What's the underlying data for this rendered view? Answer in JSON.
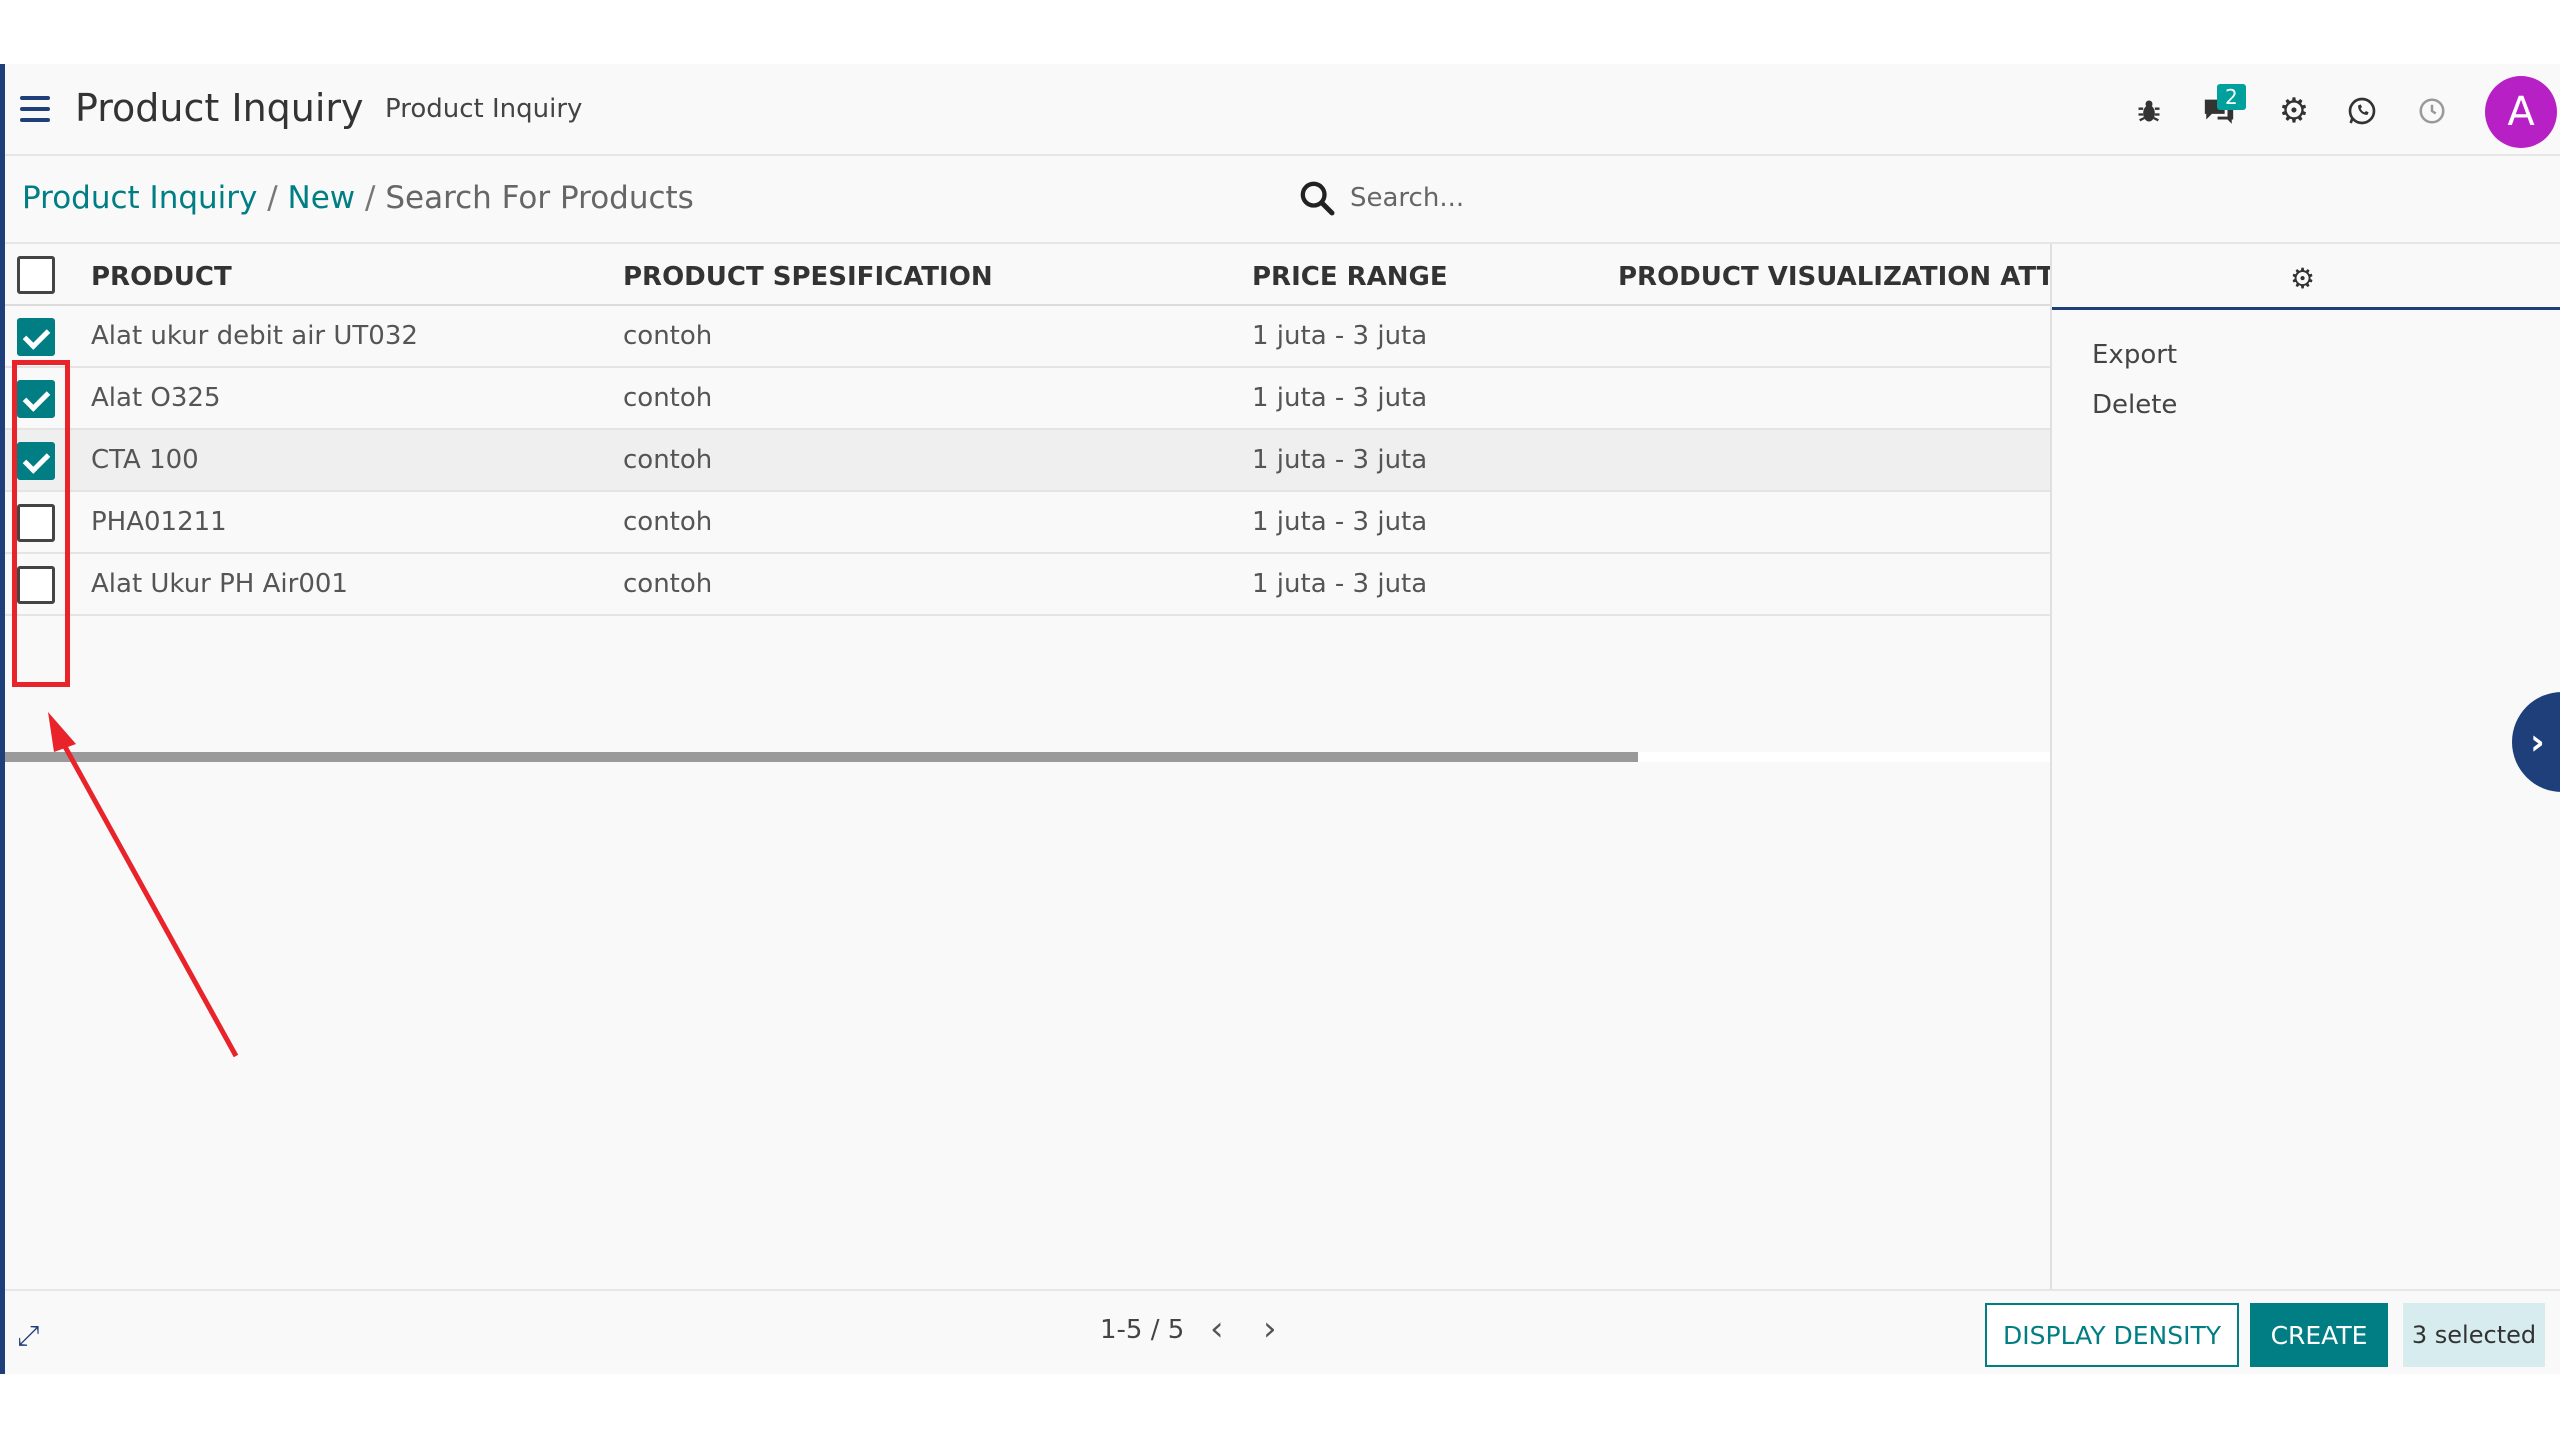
{
  "topbar": {
    "title": "Product Inquiry",
    "subtitle": "Product Inquiry",
    "chat_count": "2",
    "avatar_letter": "A"
  },
  "breadcrumb": {
    "root": "Product Inquiry",
    "sep1": " / ",
    "middle": "New",
    "sep2": " / ",
    "current": "Search For Products"
  },
  "search": {
    "placeholder": "Search..."
  },
  "table": {
    "headers": {
      "product": "PRODUCT",
      "specification": "PRODUCT SPESIFICATION",
      "price": "PRICE RANGE",
      "attachment": "PRODUCT VISUALIZATION ATTACHMENT"
    },
    "rows": [
      {
        "product": "Alat ukur debit air UT032",
        "spec": "contoh",
        "price": "1 juta - 3 juta",
        "checked": true
      },
      {
        "product": "Alat O325",
        "spec": "contoh",
        "price": "1 juta - 3 juta",
        "checked": true
      },
      {
        "product": "CTA 100",
        "spec": "contoh",
        "price": "1 juta - 3 juta",
        "checked": true
      },
      {
        "product": "PHA01211",
        "spec": "contoh",
        "price": "1 juta - 3 juta",
        "checked": false
      },
      {
        "product": "Alat Ukur PH Air001",
        "spec": "contoh",
        "price": "1 juta - 3 juta",
        "checked": false
      }
    ]
  },
  "sidebar": {
    "actions": [
      "Export",
      "Delete"
    ]
  },
  "footer": {
    "pager": "1-5 / 5",
    "display_density": "DISPLAY DENSITY",
    "create": "CREATE",
    "selected": "3 selected"
  },
  "colors": {
    "accent": "#017e84",
    "nav": "#1f3f7a",
    "annotation": "#e8232a",
    "avatar": "#b620c4"
  }
}
